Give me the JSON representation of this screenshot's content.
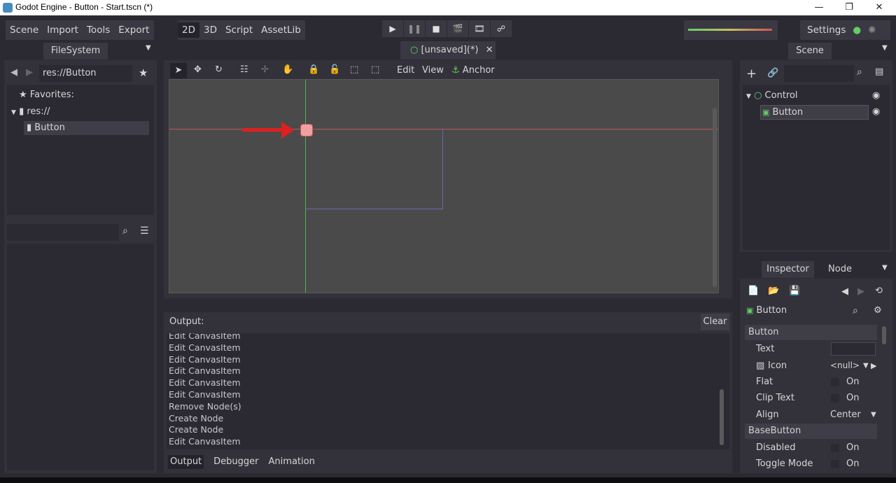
{
  "window": {
    "title": "Godot Engine - Button - Start.tscn (*)",
    "minimize_glyph": "—",
    "restore_glyph": "❐",
    "close_glyph": "✕"
  },
  "menu": {
    "items": [
      "Scene",
      "Import",
      "Tools",
      "Export"
    ]
  },
  "modes": {
    "items": [
      "2D",
      "3D",
      "Script",
      "AssetLib"
    ],
    "active": "2D"
  },
  "play_controls": [
    "play-icon",
    "pause-icon",
    "stop-icon",
    "play-scene-icon",
    "play-custom-scene-icon",
    "remote-debug-icon"
  ],
  "settings": {
    "label": "Settings"
  },
  "filesystem": {
    "tab_label": "FileSystem",
    "path": "res://Button",
    "favorites_label": "Favorites:",
    "root_label": "res://",
    "folder_label": "Button"
  },
  "scene_tab": {
    "label": "[unsaved](*)"
  },
  "canvas_toolbar": {
    "edit_label": "Edit",
    "view_label": "View",
    "anchor_label": "Anchor"
  },
  "output": {
    "header": "Output:",
    "clear_label": "Clear",
    "lines": [
      "Edit CanvasItem",
      "Edit CanvasItem",
      "Edit CanvasItem",
      "Edit CanvasItem",
      "Edit CanvasItem",
      "Edit CanvasItem",
      "Remove Node(s)",
      "Create Node",
      "Create Node",
      "Edit CanvasItem"
    ],
    "tabs": [
      "Output",
      "Debugger",
      "Animation"
    ],
    "active_tab": "Output"
  },
  "scene_dock": {
    "tab_label": "Scene",
    "tree": [
      {
        "label": "Control",
        "icon": "control-node-icon"
      },
      {
        "label": "Button",
        "icon": "button-node-icon"
      }
    ]
  },
  "inspector": {
    "tab_label": "Inspector",
    "node_tab_label": "Node",
    "object_label": "Button",
    "sections": {
      "button": "Button",
      "basebutton": "BaseButton"
    },
    "props": {
      "text_label": "Text",
      "icon_label": "Icon",
      "icon_value": "<null>",
      "flat_label": "Flat",
      "flat_value": "On",
      "clip_label": "Clip Text",
      "clip_value": "On",
      "align_label": "Align",
      "align_value": "Center",
      "disabled_label": "Disabled",
      "disabled_value": "On",
      "toggle_label": "Toggle Mode",
      "toggle_value": "On"
    }
  },
  "colors": {
    "editor_bg": "#2b2a33",
    "panel_bg": "#33323b",
    "accent_green": "#66cc66",
    "guide_red": "#c05a5a",
    "guide_green": "#55b055"
  }
}
